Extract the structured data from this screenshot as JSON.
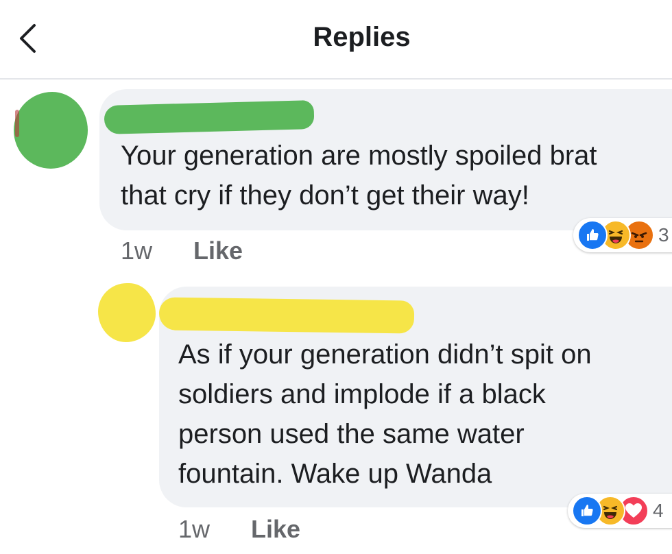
{
  "header": {
    "title": "Replies",
    "back_icon": "chevron-left-icon"
  },
  "colors": {
    "bubble": "#f0f2f5",
    "meta_text": "#65676b",
    "like_blue": "#1877f2",
    "haha_yellow": "#f7b928",
    "angry_orange": "#e9710f",
    "love_red": "#f33e58",
    "redaction_green": "#5cb85c",
    "redaction_yellow": "#f6e548"
  },
  "comments": [
    {
      "text_lines": [
        "Your generation are mostly spoiled brat",
        "that cry if they don’t get their way!"
      ],
      "time": "1w",
      "like_label": "Like",
      "reactions": [
        "like-icon",
        "haha-icon",
        "angry-icon"
      ],
      "reaction_count": "3"
    },
    {
      "text_lines": [
        "As if your generation didn’t spit on",
        "soldiers and implode if a black",
        "person used the same water",
        "fountain. Wake up Wanda"
      ],
      "time": "1w",
      "like_label": "Like",
      "reactions": [
        "like-icon",
        "haha-icon",
        "love-icon"
      ],
      "reaction_count": "4"
    }
  ]
}
